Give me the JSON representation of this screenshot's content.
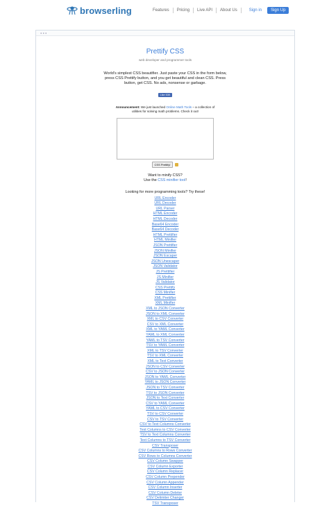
{
  "header": {
    "brand": "browserling",
    "nav": [
      "Features",
      "Pricing",
      "Live API",
      "About Us"
    ],
    "signin": "Sign in",
    "signup": "Sign Up"
  },
  "main": {
    "title": "Prettify CSS",
    "subtitle": "web developer and programmer tools",
    "intro": "World's simplest CSS beautifier. Just paste your CSS in the form below, press CSS Prettify button, and you get beautiful and clean CSS. Press button, get CSS. No ads, nonsense or garbage.",
    "like": "Like 53K",
    "announce_label": "Announcement:",
    "announce_pre": " We just launched ",
    "announce_link": "Online Math Tools",
    "announce_post": " – a collection of utilities for solving math problems. Check it out!",
    "button": "CSS Prettify!",
    "minify_q": "Want to minify CSS?",
    "minify_pre": "Use the ",
    "minify_link": "CSS minifier tool",
    "minify_post": "!",
    "more": "Looking for more programming tools? Try these!"
  },
  "colors": {
    "accent": "#3b7dd8",
    "brand": "#2f76b5"
  },
  "tools": [
    "URL Encoder",
    "URL Decoder",
    "URL Parser",
    "HTML Encoder",
    "HTML Decoder",
    "Base64 Encoder",
    "Base64 Decoder",
    "HTML Prettifier",
    "HTML Minifier",
    "JSON Prettifier",
    "JSON Minifier",
    "JSON Escaper",
    "JSON Unescaper",
    "JSON Validator",
    "JS Prettifier",
    "JS Minifier",
    "JS Validator",
    "CSS Prettify",
    "CSS Minifier",
    "XML Prettifier",
    "XML Minifier",
    "XML to JSON Converter",
    "JSON to XML Converter",
    "XML to CSV Converter",
    "CSV to XML Converter",
    "XML to YAML Converter",
    "YAML to XML Converter",
    "YAML to TSV Converter",
    "TSV to YAML Converter",
    "XML to TSV Converter",
    "TSV to XML Converter",
    "XML to Text Converter",
    "JSON to CSV Converter",
    "CSV to JSON Converter",
    "JSON to YAML Converter",
    "YAML to JSON Converter",
    "JSON to TSV Converter",
    "TSV to JSON Converter",
    "JSON to Text Converter",
    "CSV to YAML Converter",
    "YAML to CSV Converter",
    "TSV to CSV Converter",
    "CSV to TSV Converter",
    "CSV to Text Columns Converter",
    "Text Columns to CSV Converter",
    "TSV to Text Columns Converter",
    "Text Columns to TSV Converter",
    "CSV Transposer",
    "CSV Columns to Rows Converter",
    "CSV Rows to Columns Converter",
    "CSV Column Swapper",
    "CSV Column Exporter",
    "CSV Column Replacer",
    "CSV Column Prepender",
    "CSV Column Appender",
    "CSV Column Inserter",
    "CSV Column Deleter",
    "CSV Delimiter Changer",
    "TSV Transposer"
  ]
}
